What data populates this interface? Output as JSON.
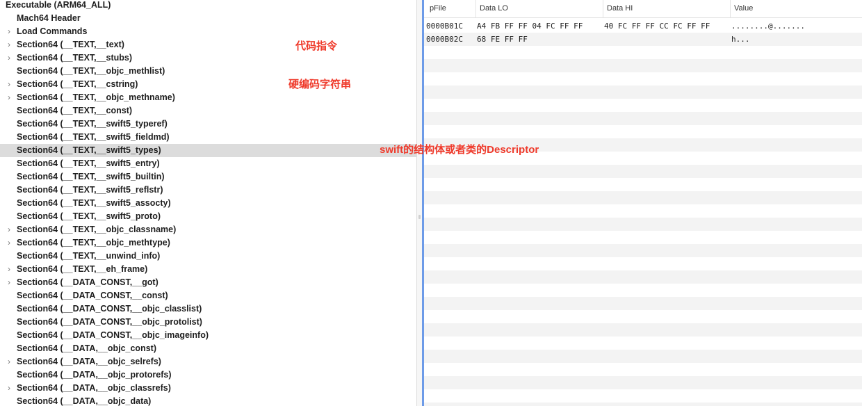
{
  "tree": {
    "root": "Executable  (ARM64_ALL)",
    "items": [
      {
        "label": "Mach64 Header",
        "expandable": false,
        "selected": false
      },
      {
        "label": "Load Commands",
        "expandable": true,
        "selected": false
      },
      {
        "label": "Section64 (__TEXT,__text)",
        "expandable": true,
        "selected": false
      },
      {
        "label": "Section64 (__TEXT,__stubs)",
        "expandable": true,
        "selected": false
      },
      {
        "label": "Section64 (__TEXT,__objc_methlist)",
        "expandable": false,
        "selected": false
      },
      {
        "label": "Section64 (__TEXT,__cstring)",
        "expandable": true,
        "selected": false
      },
      {
        "label": "Section64 (__TEXT,__objc_methname)",
        "expandable": true,
        "selected": false
      },
      {
        "label": "Section64 (__TEXT,__const)",
        "expandable": false,
        "selected": false
      },
      {
        "label": "Section64 (__TEXT,__swift5_typeref)",
        "expandable": false,
        "selected": false
      },
      {
        "label": "Section64 (__TEXT,__swift5_fieldmd)",
        "expandable": false,
        "selected": false
      },
      {
        "label": "Section64 (__TEXT,__swift5_types)",
        "expandable": false,
        "selected": true
      },
      {
        "label": "Section64 (__TEXT,__swift5_entry)",
        "expandable": false,
        "selected": false
      },
      {
        "label": "Section64 (__TEXT,__swift5_builtin)",
        "expandable": false,
        "selected": false
      },
      {
        "label": "Section64 (__TEXT,__swift5_reflstr)",
        "expandable": false,
        "selected": false
      },
      {
        "label": "Section64 (__TEXT,__swift5_assocty)",
        "expandable": false,
        "selected": false
      },
      {
        "label": "Section64 (__TEXT,__swift5_proto)",
        "expandable": false,
        "selected": false
      },
      {
        "label": "Section64 (__TEXT,__objc_classname)",
        "expandable": true,
        "selected": false
      },
      {
        "label": "Section64 (__TEXT,__objc_methtype)",
        "expandable": true,
        "selected": false
      },
      {
        "label": "Section64 (__TEXT,__unwind_info)",
        "expandable": false,
        "selected": false
      },
      {
        "label": "Section64 (__TEXT,__eh_frame)",
        "expandable": true,
        "selected": false
      },
      {
        "label": "Section64 (__DATA_CONST,__got)",
        "expandable": true,
        "selected": false
      },
      {
        "label": "Section64 (__DATA_CONST,__const)",
        "expandable": false,
        "selected": false
      },
      {
        "label": "Section64 (__DATA_CONST,__objc_classlist)",
        "expandable": false,
        "selected": false
      },
      {
        "label": "Section64 (__DATA_CONST,__objc_protolist)",
        "expandable": false,
        "selected": false
      },
      {
        "label": "Section64 (__DATA_CONST,__objc_imageinfo)",
        "expandable": false,
        "selected": false
      },
      {
        "label": "Section64 (__DATA,__objc_const)",
        "expandable": false,
        "selected": false
      },
      {
        "label": "Section64 (__DATA,__objc_selrefs)",
        "expandable": true,
        "selected": false
      },
      {
        "label": "Section64 (__DATA,__objc_protorefs)",
        "expandable": false,
        "selected": false
      },
      {
        "label": "Section64 (__DATA,__objc_classrefs)",
        "expandable": true,
        "selected": false
      },
      {
        "label": "Section64 (__DATA,__objc_data)",
        "expandable": false,
        "selected": false
      }
    ]
  },
  "table": {
    "columns": [
      "pFile",
      "Data LO",
      "Data HI",
      "Value"
    ],
    "rows": [
      {
        "pfile": "0000B01C",
        "data_lo": "A4 FB FF FF 04 FC FF FF",
        "data_hi": "40 FC FF FF CC FC FF FF",
        "value": "........@......."
      },
      {
        "pfile": "0000B02C",
        "data_lo": "68 FE FF FF",
        "data_hi": "",
        "value": "h..."
      }
    ]
  },
  "annotations": [
    {
      "text": "代码指令"
    },
    {
      "text": "硬编码字符串"
    },
    {
      "text": "swift的结构体或者类的Descriptor"
    }
  ],
  "icons": {
    "collapsed_row": "chevron-right-icon"
  },
  "colors": {
    "annotation": "#ef3a2b",
    "selection": "#dcdcdc",
    "focus_border": "#6d9be8",
    "stripe": "#f3f3f3"
  }
}
